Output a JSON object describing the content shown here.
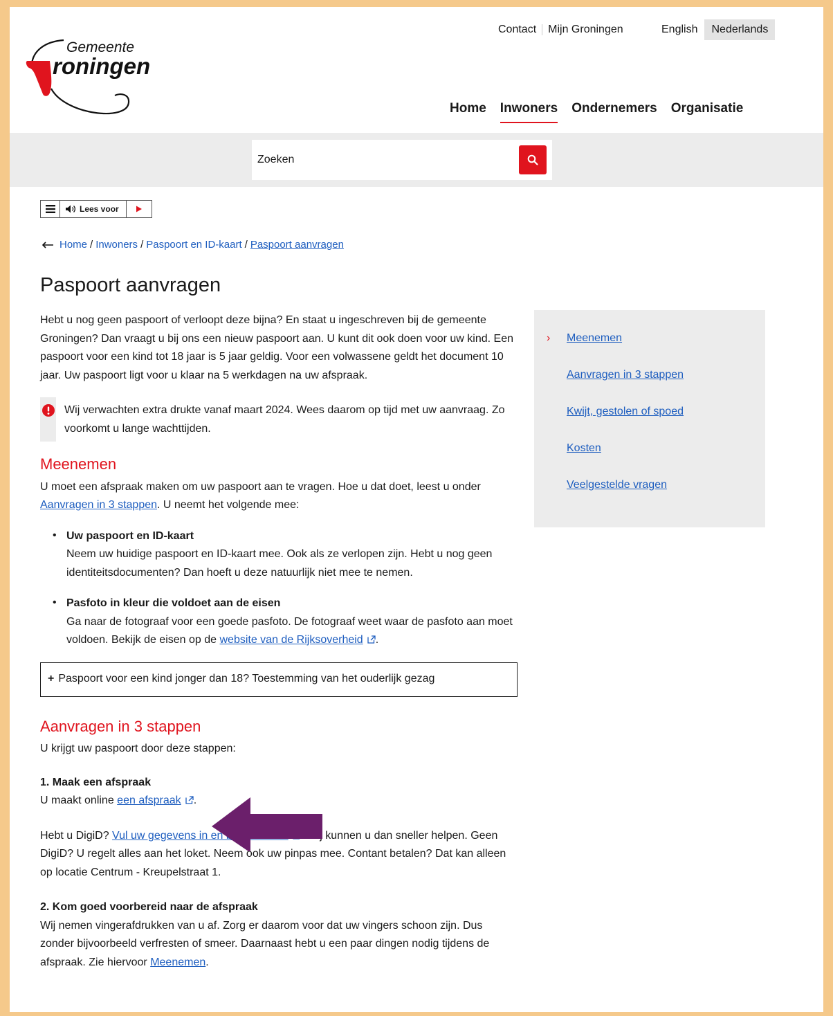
{
  "header": {
    "logo_text_1": "Gemeente",
    "logo_text_2": "roningen",
    "top_links": [
      "Contact",
      "Mijn Groningen"
    ],
    "languages": [
      "English",
      "Nederlands"
    ],
    "active_language": "Nederlands",
    "nav": [
      "Home",
      "Inwoners",
      "Ondernemers",
      "Organisatie"
    ],
    "active_nav": "Inwoners"
  },
  "search": {
    "placeholder": "Zoeken"
  },
  "readspeaker": {
    "label": "Lees voor"
  },
  "breadcrumb": [
    "Home",
    "Inwoners",
    "Paspoort en ID-kaart",
    "Paspoort aanvragen"
  ],
  "page": {
    "title": "Paspoort aanvragen",
    "intro": "Hebt u nog geen paspoort of verloopt deze bijna? En staat u ingeschreven bij de gemeente Groningen? Dan vraagt u bij ons een nieuw paspoort aan. U kunt dit ook doen voor uw kind. Een paspoort voor een kind tot 18 jaar is 5 jaar geldig. Voor een volwassene geldt het document 10 jaar. Uw paspoort ligt voor u klaar na 5 werkdagen na uw afspraak.",
    "notice": "Wij verwachten extra drukte vanaf maart 2024. Wees daarom op tijd met uw aanvraag. Zo voorkomt u lange wachttijden.",
    "meenemen": {
      "heading": "Meenemen",
      "text_before": "U moet een afspraak maken om uw paspoort aan te vragen. Hoe u dat doet, leest u onder ",
      "link": "Aanvragen in 3 stappen",
      "text_after": ". U neemt het volgende mee:",
      "items": [
        {
          "title": "Uw paspoort en ID-kaart",
          "text": "Neem uw huidige paspoort en ID-kaart mee. Ook als ze verlopen zijn. Hebt u nog geen identiteitsdocumenten? Dan hoeft u deze natuurlijk niet mee te nemen."
        },
        {
          "title": "Pasfoto in kleur die voldoet aan de eisen",
          "text": "Ga naar de fotograaf voor een goede pasfoto. De fotograaf weet waar de pasfoto aan moet voldoen. Bekijk de eisen op de ",
          "link": "website van de Rijksoverheid",
          "after": "."
        }
      ],
      "accordion": "Paspoort voor een kind jonger dan 18? Toestemming van het ouderlijk gezag"
    },
    "stappen": {
      "heading": "Aanvragen in 3 stappen",
      "intro": "U krijgt uw paspoort door deze stappen:",
      "step1_title": "1. Maak een afspraak",
      "step1_before": "U maakt online ",
      "step1_link": "een afspraak",
      "step1_after": ".",
      "digid_before": "Hebt u DigiD? ",
      "digid_link": "Vul uw gegevens in en betaal alvast",
      "digid_after": ". Wij kunnen u dan sneller helpen. Geen DigiD? U regelt alles aan het loket. Neem ook uw pinpas mee. Contant betalen? Dat kan alleen op locatie Centrum - Kreupelstraat 1.",
      "step2_title": "2. Kom goed voorbereid naar de afspraak",
      "step2_before": "Wij nemen vingerafdrukken van u af. Zorg er daarom voor dat uw vingers schoon zijn. Dus zonder bijvoorbeeld verfresten of smeer. Daarnaast hebt u een paar dingen nodig tijdens de afspraak. Zie hiervoor ",
      "step2_link": "Meenemen",
      "step2_after": "."
    }
  },
  "sidebar": [
    "Meenemen",
    "Aanvragen in 3 stappen",
    "Kwijt, gestolen of spoed",
    "Kosten",
    "Veelgestelde vragen"
  ],
  "colors": {
    "brand_red": "#e0141e",
    "link_blue": "#1d5dbf",
    "annotation_arrow": "#6b1f6b"
  }
}
